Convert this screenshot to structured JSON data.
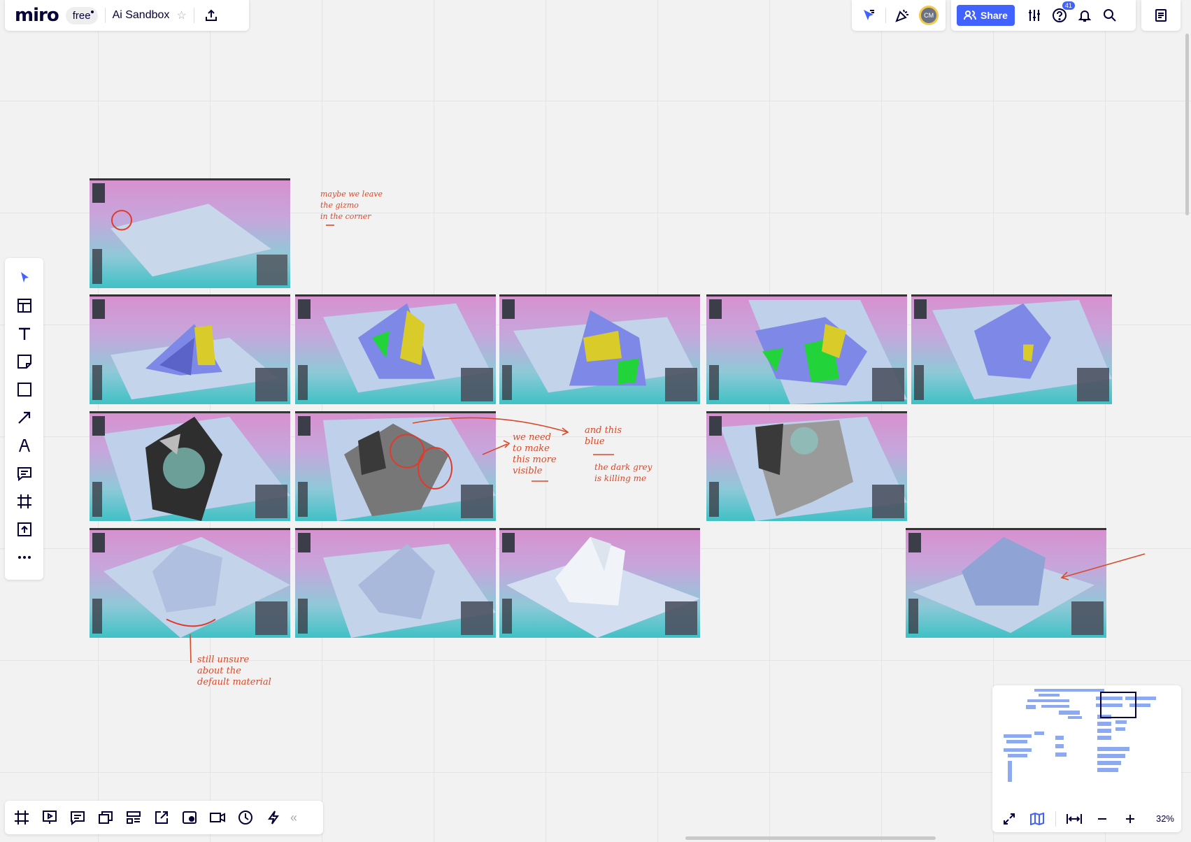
{
  "app": {
    "logo": "miro",
    "plan": "free",
    "board_title": "Ai Sandbox"
  },
  "header": {
    "avatar_initials": "CM",
    "share_label": "Share",
    "help_badge_count": "41"
  },
  "left_toolbar": {
    "tools": [
      "select",
      "templates",
      "text",
      "sticky-note",
      "shapes",
      "connection-line",
      "pen",
      "comment",
      "frame",
      "upload",
      "more"
    ]
  },
  "bottom_toolbar": {
    "tools": [
      "frames",
      "presentation",
      "comments",
      "cards",
      "kanban",
      "embed",
      "screenshot",
      "video",
      "timer",
      "lightning"
    ],
    "collapse": "«"
  },
  "minimap": {
    "zoom_label": "32%"
  },
  "annotations": [
    {
      "id": "note-gizmo",
      "text": "maybe we leave\nthe gizmo\nin the corner"
    },
    {
      "id": "note-visible",
      "text": "we need\nto make\nthis more\nvisible"
    },
    {
      "id": "note-blue",
      "text": "and this\nblue"
    },
    {
      "id": "note-grey",
      "text": "the dark grey\nis killing me"
    },
    {
      "id": "note-material",
      "text": "still unsure\nabout the\ndefault material"
    }
  ],
  "colors": {
    "accent": "#4262ff",
    "annotation": "#d84a2a",
    "canvas": "#f2f2f2",
    "model_blue": "#7e88e6",
    "model_yellow": "#d9cb2a",
    "model_green": "#22d33a",
    "model_dark": "#3a3a3a",
    "model_white": "#c7d4ea"
  }
}
